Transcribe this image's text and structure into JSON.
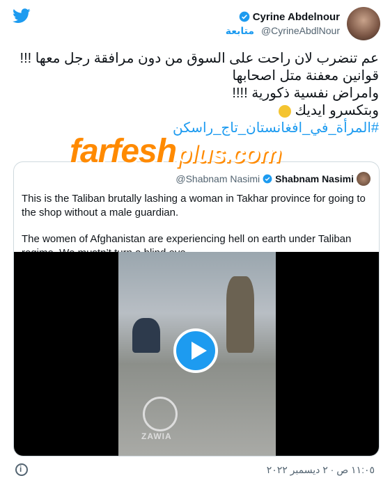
{
  "header": {
    "display_name": "Cyrine Abdelnour",
    "handle": "@CyrineAbdlNour",
    "follow_label": "متابعة"
  },
  "tweet": {
    "lines": [
      "عم تنضرب لان راحت على السوق من دون مرافقة رجل معها !!!",
      "قوانين معفنة متل اصحابها",
      "وامراض نفسية ذكورية !!!!",
      "وبتكسرو ايديك"
    ],
    "hashtag": "#المرأة_في_افغانستان_تاج_راسكن"
  },
  "quote": {
    "name": "Shabnam Nasimi",
    "handle": "@Shabnam Nasimi",
    "paragraph1": "This is the Taliban brutally lashing a woman in Takhar province for going to the shop without a male guardian.",
    "paragraph2": "The women of Afghanistan are experiencing hell on earth under Taliban regime. We mustn’t turn a blind eye.",
    "video_label": "ZAWIA"
  },
  "watermark": {
    "main": "farfesh",
    "suffix": "plus.com"
  },
  "footer": {
    "timestamp": "١١:٠٥ ص · ٢ ديسمبر ٢٠٢٢"
  },
  "colors": {
    "accent": "#1d9bf0",
    "text": "#0f1419",
    "muted": "#536471",
    "watermark": "#ff8a00"
  }
}
